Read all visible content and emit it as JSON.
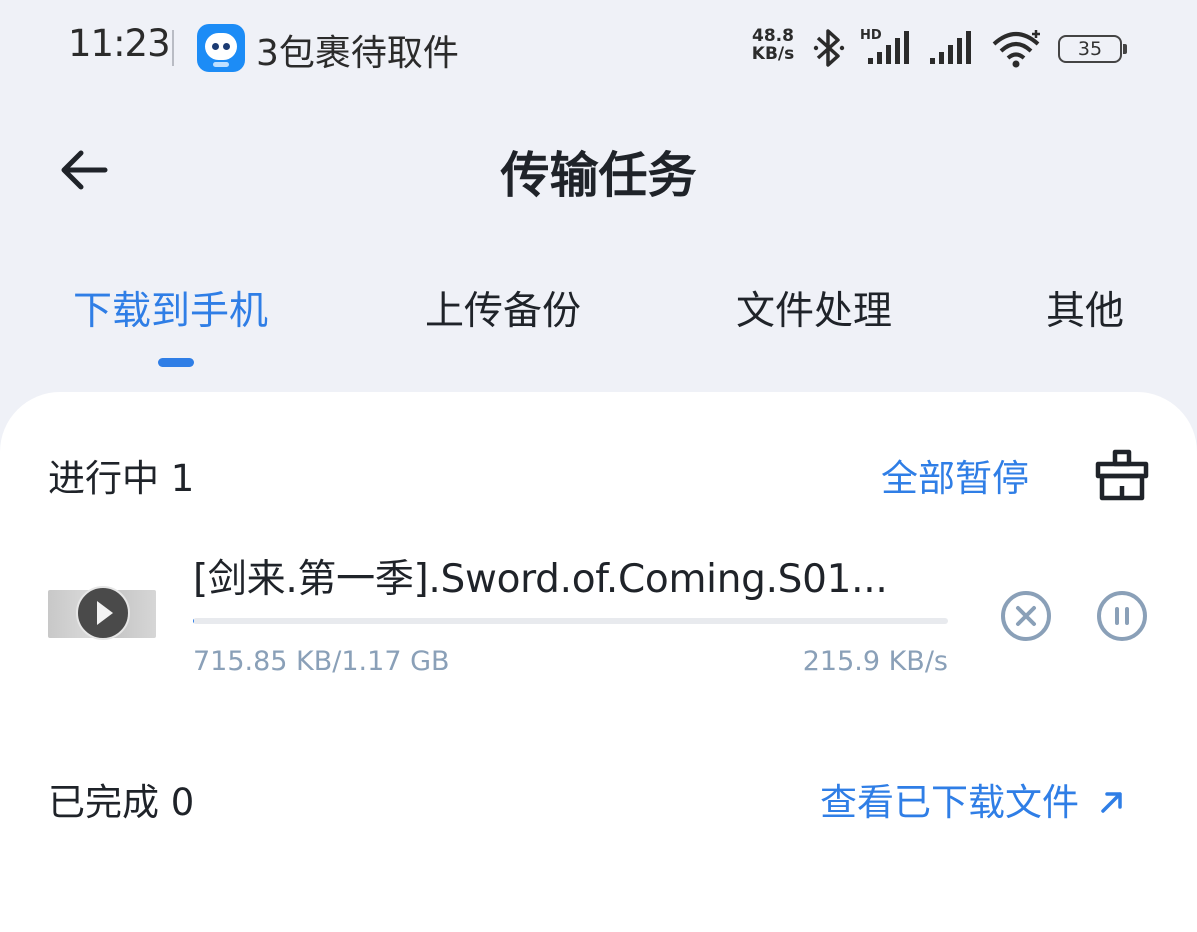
{
  "status_bar": {
    "time": "11:23",
    "notification": "3包裹待取件",
    "net_speed_value": "48.8",
    "net_speed_unit": "KB/s",
    "signal_label": "HD",
    "battery": "35"
  },
  "header": {
    "title": "传输任务",
    "back_icon": "arrow-left-icon"
  },
  "tabs": [
    {
      "label": "下载到手机",
      "active": true
    },
    {
      "label": "上传备份",
      "active": false
    },
    {
      "label": "文件处理",
      "active": false
    },
    {
      "label": "其他",
      "active": false
    }
  ],
  "in_progress": {
    "title": "进行中 1",
    "pause_all_label": "全部暂停",
    "clean_icon": "broom-icon",
    "items": [
      {
        "file_name": "[剑来.第一季].Sword.of.Coming.S01...",
        "size_progress": "715.85 KB/1.17 GB",
        "speed": "215.9 KB/s",
        "progress_fraction": 0.0006,
        "thumb_icon": "play-icon"
      }
    ]
  },
  "completed": {
    "title": "已完成 0",
    "view_files_label": "查看已下载文件",
    "view_files_icon": "arrow-up-right-icon"
  },
  "colors": {
    "accent": "#2f7ee6",
    "background": "#eff1f7",
    "card": "#ffffff",
    "muted_text": "#8aa0b8"
  }
}
